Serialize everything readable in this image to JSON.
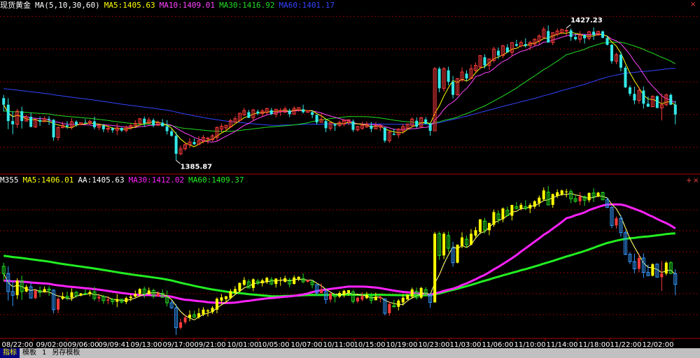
{
  "colors": {
    "up": "#ff3b3b",
    "down": "#34e8e8",
    "ma5": "#ffff00",
    "ma10": "#ff44ff",
    "ma30": "#22dd22",
    "ma60": "#3344ff",
    "grid": "#8b0000",
    "axis": "#aa0000",
    "label": "#ffffff",
    "sub_up": "#ffff00",
    "sub_down": "#22dd22",
    "sub_blue": "#3399ff",
    "sub_ma": "#ffff00",
    "sub_aa": "#ffffff",
    "sub_ma30": "#ff22ff",
    "sub_ma60": "#22ee22"
  },
  "header_main": {
    "title": "现货黄金",
    "ma_def": "MA(5,10,30,60)",
    "ma5": "MA5:1405.63",
    "ma10": "MA10:1409.01",
    "ma30": "MA30:1416.92",
    "ma60": "MA60:1401.17"
  },
  "header_sub": {
    "title": "M355",
    "ma5": "MA5:1406.01",
    "aa": "AA:1405.63",
    "ma30": "MA30:1412.02",
    "ma60": "MA60:1409.37"
  },
  "corner_icons": {
    "close": "×",
    "plus": "+"
  },
  "bottom_tabs": [
    "指标",
    "模板",
    "1",
    "另存模板"
  ],
  "chart_data": [
    {
      "type": "candlestick",
      "x_labels": [
        "08/22:00",
        "09/02:00",
        "09/06:00",
        "09/09:41",
        "09/13:00",
        "09/17:00",
        "09/21:00",
        "10/01:00",
        "10/05:00",
        "10/07:00",
        "10/11:00",
        "10/15:00",
        "10/19:00",
        "10/23:00",
        "11/03:00",
        "11/06:00",
        "11/10:00",
        "11/14:00",
        "11/18:00",
        "11/22:00",
        "12/02:00"
      ],
      "ylim": [
        1382,
        1432
      ],
      "annotations": [
        {
          "text": "1427.23",
          "index": 124
        },
        {
          "text": "1385.87",
          "index": 38
        }
      ],
      "candles": [
        [
          1405.0,
          1403.0,
          1406.0,
          1400.9
        ],
        [
          1403.0,
          1398.0,
          1405.0,
          1395.5
        ],
        [
          1398.0,
          1397.0,
          1401.0,
          1394.0
        ],
        [
          1397.0,
          1401.0,
          1401.7,
          1395.9
        ],
        [
          1401.0,
          1398.0,
          1402.4,
          1395.7
        ],
        [
          1398.0,
          1399.3,
          1399.9,
          1397.8
        ],
        [
          1399.3,
          1396.2,
          1400.6,
          1396.1
        ],
        [
          1396.2,
          1398.3,
          1398.5,
          1395.9
        ],
        [
          1398.3,
          1397.8,
          1399.4,
          1396.5
        ],
        [
          1397.8,
          1398.7,
          1399.4,
          1397.7
        ],
        [
          1398.7,
          1398.4,
          1399.5,
          1396.8
        ],
        [
          1398.4,
          1393.0,
          1398.6,
          1392.0
        ],
        [
          1393.0,
          1396.0,
          1396.4,
          1392.0
        ],
        [
          1396.0,
          1396.7,
          1397.8,
          1395.7
        ],
        [
          1396.7,
          1396.3,
          1398.0,
          1395.6
        ],
        [
          1396.3,
          1397.8,
          1398.9,
          1395.4
        ],
        [
          1397.8,
          1396.9,
          1398.2,
          1396.3
        ],
        [
          1396.9,
          1397.5,
          1397.6,
          1396.7
        ],
        [
          1397.5,
          1397.3,
          1398.6,
          1397.2
        ],
        [
          1397.3,
          1397.9,
          1398.4,
          1396.7
        ],
        [
          1397.9,
          1396.1,
          1399.3,
          1395.5
        ],
        [
          1396.1,
          1396.6,
          1397.1,
          1395.2
        ],
        [
          1396.6,
          1395.5,
          1397.1,
          1394.6
        ],
        [
          1395.5,
          1395.8,
          1396.8,
          1394.5
        ],
        [
          1395.8,
          1395.2,
          1396.2,
          1394.4
        ],
        [
          1395.2,
          1395.9,
          1397.3,
          1393.7
        ],
        [
          1395.9,
          1395.1,
          1396.0,
          1394.7
        ],
        [
          1395.1,
          1396.2,
          1396.6,
          1394.5
        ],
        [
          1396.2,
          1396.6,
          1397.2,
          1395.3
        ],
        [
          1396.6,
          1397.3,
          1398.3,
          1396.4
        ],
        [
          1397.3,
          1398.7,
          1399.0,
          1396.6
        ],
        [
          1398.7,
          1397.3,
          1399.4,
          1396.2
        ],
        [
          1397.3,
          1398.3,
          1399.1,
          1397.1
        ],
        [
          1398.3,
          1396.7,
          1398.8,
          1396.1
        ],
        [
          1396.7,
          1397.5,
          1398.1,
          1396.6
        ],
        [
          1397.5,
          1396.4,
          1398.6,
          1396.4
        ],
        [
          1396.4,
          1394.9,
          1398.3,
          1393.9
        ],
        [
          1394.9,
          1393.5,
          1395.6,
          1393.2
        ],
        [
          1393.5,
          1388.0,
          1394.6,
          1386.0
        ],
        [
          1388.0,
          1389.5,
          1390.5,
          1387.5
        ],
        [
          1389.5,
          1390.8,
          1391.4,
          1389.0
        ],
        [
          1390.8,
          1391.6,
          1392.8,
          1389.8
        ],
        [
          1391.6,
          1390.9,
          1392.7,
          1390.7
        ],
        [
          1390.9,
          1392.0,
          1393.4,
          1390.5
        ],
        [
          1391.7,
          1393.0,
          1393.7,
          1391.2
        ],
        [
          1392.5,
          1392.8,
          1393.2,
          1391.1
        ],
        [
          1392.3,
          1393.5,
          1394.0,
          1391.8
        ],
        [
          1393.0,
          1396.0,
          1396.4,
          1392.0
        ],
        [
          1395.5,
          1396.4,
          1397.3,
          1394.6
        ],
        [
          1395.9,
          1396.7,
          1396.8,
          1394.9
        ],
        [
          1396.2,
          1398.1,
          1398.7,
          1395.9
        ],
        [
          1397.6,
          1398.7,
          1399.5,
          1397.5
        ],
        [
          1398.2,
          1400.4,
          1400.5,
          1397.8
        ],
        [
          1399.9,
          1401.2,
          1402.0,
          1399.5
        ],
        [
          1400.7,
          1399.0,
          1401.4,
          1398.9
        ],
        [
          1399.0,
          1401.4,
          1401.7,
          1398.1
        ],
        [
          1400.9,
          1400.3,
          1401.5,
          1399.8
        ],
        [
          1400.3,
          1401.1,
          1401.6,
          1399.4
        ],
        [
          1400.6,
          1401.8,
          1402.1,
          1400.1
        ],
        [
          1401.3,
          1400.1,
          1402.0,
          1399.8
        ],
        [
          1400.1,
          1401.6,
          1401.7,
          1399.1
        ],
        [
          1401.1,
          1401.2,
          1402.0,
          1399.6
        ],
        [
          1400.7,
          1401.7,
          1402.4,
          1400.5
        ],
        [
          1401.2,
          1400.1,
          1401.8,
          1399.2
        ],
        [
          1400.1,
          1401.9,
          1402.5,
          1400.0
        ],
        [
          1401.4,
          1402.1,
          1402.2,
          1400.9
        ],
        [
          1401.6,
          1400.7,
          1403.0,
          1400.3
        ],
        [
          1400.7,
          1401.2,
          1401.3,
          1400.5
        ],
        [
          1400.7,
          1399.9,
          1401.3,
          1398.9
        ],
        [
          1399.9,
          1397.6,
          1400.0,
          1396.9
        ],
        [
          1397.6,
          1398.5,
          1400.3,
          1397.5
        ],
        [
          1398.0,
          1395.8,
          1398.7,
          1394.6
        ],
        [
          1395.8,
          1397.5,
          1397.6,
          1395.0
        ],
        [
          1397.0,
          1396.6,
          1397.3,
          1395.0
        ],
        [
          1396.6,
          1397.6,
          1398.1,
          1396.2
        ],
        [
          1397.1,
          1398.2,
          1398.5,
          1396.4
        ],
        [
          1397.7,
          1398.4,
          1398.4,
          1396.8
        ],
        [
          1397.9,
          1395.3,
          1398.5,
          1394.7
        ],
        [
          1395.3,
          1396.3,
          1396.6,
          1394.8
        ],
        [
          1395.8,
          1396.7,
          1397.8,
          1395.3
        ],
        [
          1396.2,
          1397.1,
          1397.9,
          1395.9
        ],
        [
          1396.6,
          1395.6,
          1397.7,
          1394.6
        ],
        [
          1395.6,
          1396.6,
          1397.7,
          1395.6
        ],
        [
          1396.1,
          1396.5,
          1397.0,
          1395.0
        ],
        [
          1396.0,
          1392.0,
          1396.1,
          1391.4
        ],
        [
          1392.0,
          1394.6,
          1395.2,
          1391.3
        ],
        [
          1394.1,
          1393.8,
          1395.7,
          1393.6
        ],
        [
          1393.8,
          1395.5,
          1395.9,
          1392.8
        ],
        [
          1395.0,
          1396.3,
          1397.2,
          1394.1
        ],
        [
          1395.8,
          1397.1,
          1397.2,
          1395.8
        ],
        [
          1396.6,
          1398.6,
          1399.1,
          1396.0
        ],
        [
          1398.1,
          1396.3,
          1399.1,
          1395.8
        ],
        [
          1396.3,
          1399.0,
          1399.3,
          1395.9
        ],
        [
          1398.5,
          1397.2,
          1399.2,
          1397.0
        ],
        [
          1397.2,
          1395.0,
          1397.5,
          1393.5
        ],
        [
          1395.0,
          1414.0,
          1414.5,
          1395.2
        ],
        [
          1414.0,
          1408.0,
          1414.6,
          1406.8
        ],
        [
          1408.0,
          1414.0,
          1414.5,
          1407.0
        ],
        [
          1413.5,
          1410.0,
          1414.6,
          1408.9
        ],
        [
          1410.0,
          1406.0,
          1411.8,
          1404.9
        ],
        [
          1406.0,
          1411.0,
          1411.0,
          1405.8
        ],
        [
          1410.5,
          1413.0,
          1414.4,
          1410.0
        ],
        [
          1412.5,
          1411.0,
          1413.5,
          1410.2
        ],
        [
          1411.0,
          1414.0,
          1415.3,
          1410.8
        ],
        [
          1413.5,
          1415.0,
          1415.9,
          1413.0
        ],
        [
          1414.5,
          1418.0,
          1418.0,
          1413.9
        ],
        [
          1417.5,
          1415.0,
          1418.4,
          1414.1
        ],
        [
          1415.0,
          1417.0,
          1417.0,
          1413.6
        ],
        [
          1416.5,
          1420.0,
          1420.7,
          1415.9
        ],
        [
          1419.5,
          1418.0,
          1420.5,
          1416.9
        ],
        [
          1418.0,
          1421.0,
          1421.3,
          1417.2
        ],
        [
          1420.5,
          1419.0,
          1421.5,
          1418.9
        ],
        [
          1419.0,
          1422.0,
          1422.0,
          1417.7
        ],
        [
          1421.5,
          1421.0,
          1422.8,
          1420.7
        ],
        [
          1421.0,
          1422.0,
          1422.6,
          1420.5
        ],
        [
          1421.5,
          1421.0,
          1423.3,
          1420.5
        ],
        [
          1421.0,
          1422.0,
          1422.5,
          1419.7
        ],
        [
          1421.5,
          1423.0,
          1423.3,
          1420.9
        ],
        [
          1422.5,
          1424.0,
          1424.6,
          1421.5
        ],
        [
          1423.5,
          1426.0,
          1426.8,
          1423.1
        ],
        [
          1425.5,
          1422.0,
          1427.23,
          1422.0
        ],
        [
          1422.0,
          1425.0,
          1425.1,
          1421.2
        ],
        [
          1424.5,
          1425.5,
          1426.3,
          1423.9
        ],
        [
          1425.0,
          1426.0,
          1426.2,
          1424.5
        ],
        [
          1425.5,
          1425.7,
          1426.4,
          1424.1
        ],
        [
          1425.7,
          1423.7,
          1426.3,
          1422.5
        ],
        [
          1423.7,
          1423.0,
          1424.8,
          1422.6
        ],
        [
          1423.0,
          1424.3,
          1425.5,
          1421.9
        ],
        [
          1424.3,
          1423.3,
          1424.6,
          1421.7
        ],
        [
          1423.3,
          1425.3,
          1425.5,
          1422.7
        ],
        [
          1425.3,
          1424.3,
          1426.6,
          1422.8
        ],
        [
          1424.3,
          1425.4,
          1425.6,
          1424.1
        ],
        [
          1425.4,
          1423.4,
          1425.7,
          1423.4
        ],
        [
          1423.4,
          1421.3,
          1424.1,
          1421.1
        ],
        [
          1421.3,
          1416.3,
          1421.6,
          1415.5
        ],
        [
          1416.3,
          1418.3,
          1418.8,
          1415.4
        ],
        [
          1418.3,
          1414.3,
          1419.2,
          1413.2
        ],
        [
          1414.3,
          1408.3,
          1414.9,
          1408.1
        ],
        [
          1408.3,
          1406.3,
          1408.9,
          1405.6
        ],
        [
          1406.3,
          1404.3,
          1408.5,
          1403.1
        ],
        [
          1404.3,
          1407.3,
          1408.5,
          1403.3
        ],
        [
          1407.3,
          1403.3,
          1408.6,
          1401.8
        ],
        [
          1403.3,
          1402.4,
          1405.5,
          1402.3
        ],
        [
          1402.4,
          1405.6,
          1405.8,
          1402.2
        ],
        [
          1405.6,
          1402.0,
          1405.8,
          1401.9
        ],
        [
          1402.0,
          1403.0,
          1406.4,
          1398.2
        ],
        [
          1403.0,
          1406.0,
          1406.4,
          1402.5
        ],
        [
          1406.0,
          1403.0,
          1406.4,
          1402.9
        ],
        [
          1403.0,
          1400.0,
          1404.2,
          1397.0
        ]
      ]
    },
    {
      "type": "bar",
      "ylim": [
        0,
        100
      ],
      "note": "sub-indicator panel M355"
    }
  ]
}
